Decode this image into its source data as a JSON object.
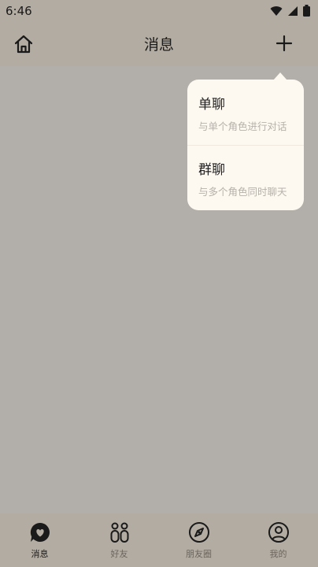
{
  "status_bar": {
    "time": "6:46"
  },
  "header": {
    "title": "消息"
  },
  "popup": {
    "items": [
      {
        "title": "单聊",
        "subtitle": "与单个角色进行对话"
      },
      {
        "title": "群聊",
        "subtitle": "与多个角色同时聊天"
      }
    ]
  },
  "tabs": [
    {
      "label": "消息",
      "icon": "chat-heart-icon",
      "active": true
    },
    {
      "label": "好友",
      "icon": "friends-icon",
      "active": false
    },
    {
      "label": "朋友圈",
      "icon": "compass-icon",
      "active": false
    },
    {
      "label": "我的",
      "icon": "profile-icon",
      "active": false
    }
  ],
  "colors": {
    "header_bg": "#b3aca2",
    "popup_bg": "#fdf8f0",
    "content_bg": "#b2afaa"
  }
}
